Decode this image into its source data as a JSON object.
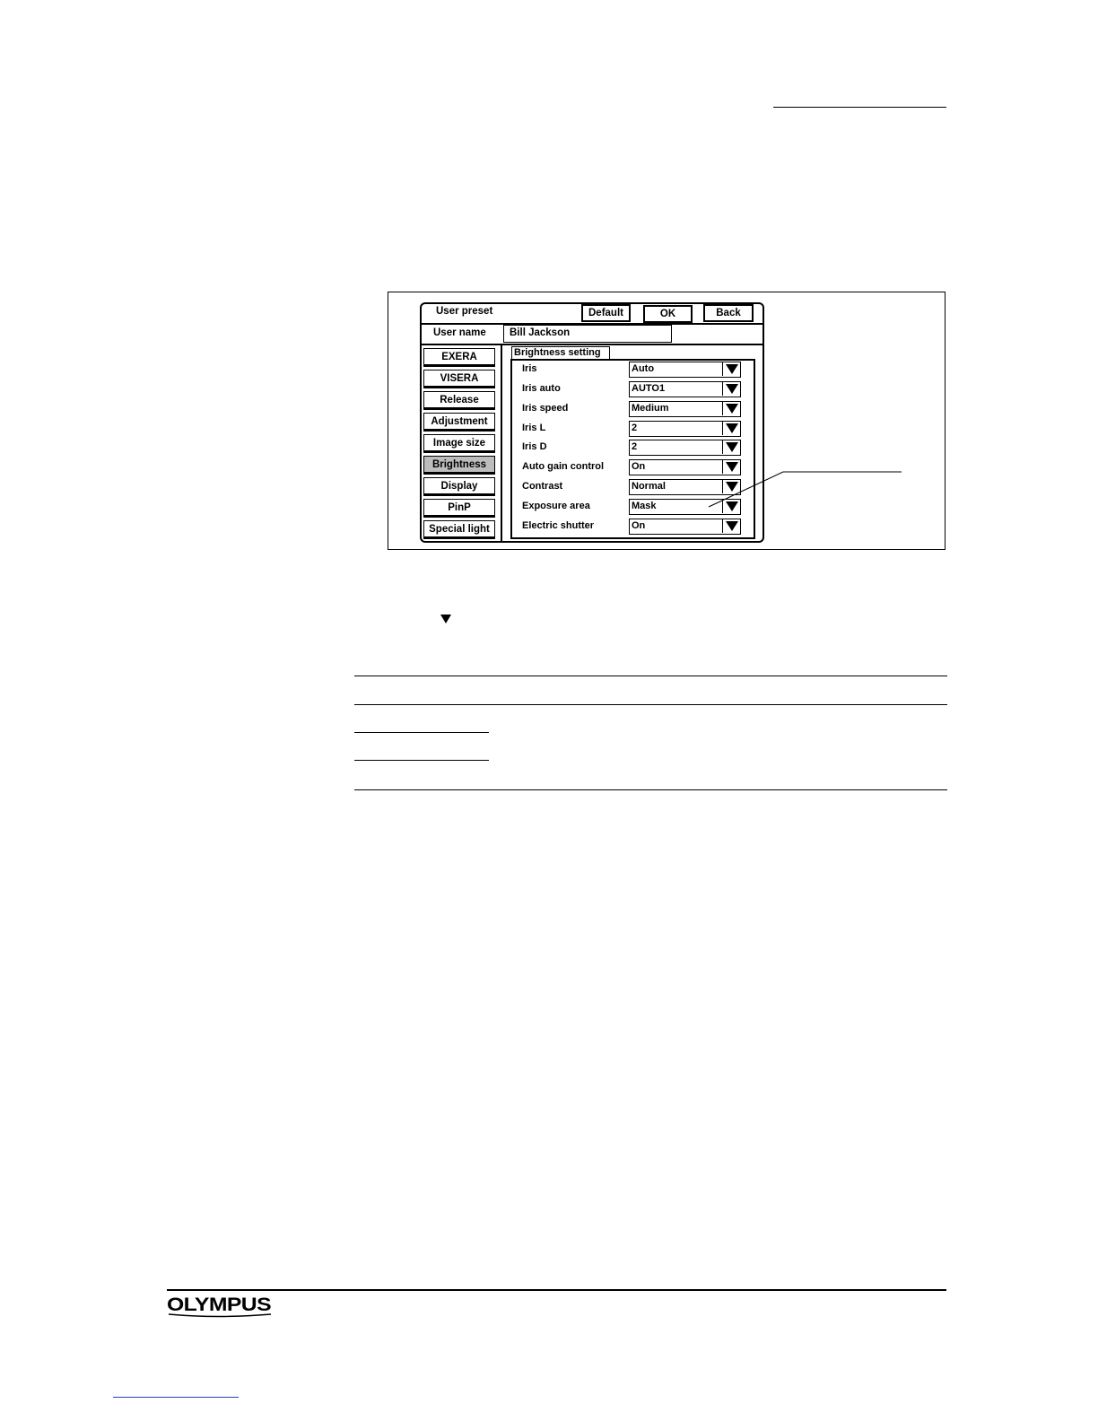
{
  "dialog": {
    "title": "User preset",
    "buttons": {
      "default": "Default",
      "ok": "OK",
      "back": "Back"
    },
    "user_name_label": "User name",
    "user_name_value": "Bill Jackson",
    "sidebar": [
      {
        "label": "EXERA",
        "active": false
      },
      {
        "label": "VISERA",
        "active": false
      },
      {
        "label": "Release",
        "active": false
      },
      {
        "label": "Adjustment",
        "active": false
      },
      {
        "label": "Image size",
        "active": false
      },
      {
        "label": "Brightness",
        "active": true
      },
      {
        "label": "Display",
        "active": false
      },
      {
        "label": "PinP",
        "active": false
      },
      {
        "label": "Special light",
        "active": false
      }
    ],
    "tab_label": "Brightness setting",
    "settings": [
      {
        "label": "Iris",
        "value": "Auto"
      },
      {
        "label": "Iris auto",
        "value": "AUTO1"
      },
      {
        "label": "Iris speed",
        "value": "Medium"
      },
      {
        "label": "Iris L",
        "value": "2"
      },
      {
        "label": "Iris D",
        "value": "2"
      },
      {
        "label": "Auto gain control",
        "value": "On"
      },
      {
        "label": "Contrast",
        "value": "Normal"
      },
      {
        "label": "Exposure area",
        "value": "Mask"
      },
      {
        "label": "Electric shutter",
        "value": "On"
      }
    ]
  },
  "icons": {
    "dropdown": "triangle-down-icon",
    "inline_arrow": "triangle-down-icon"
  },
  "footer": {
    "logo": "OLYMPUS"
  }
}
